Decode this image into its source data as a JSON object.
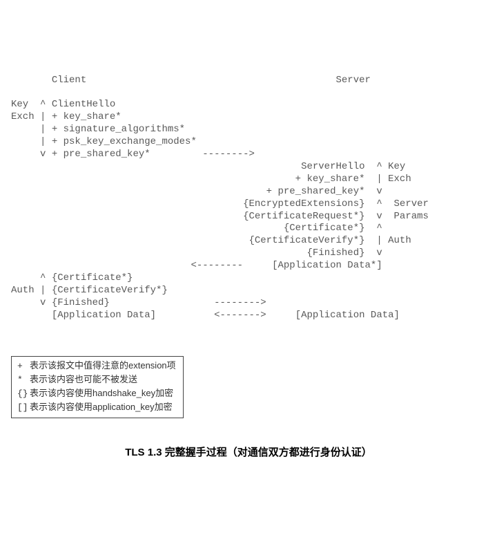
{
  "diagram": {
    "header_client": "Client",
    "header_server": "Server",
    "client_block": {
      "label_key": "Key",
      "label_exch": "Exch",
      "l1_marker": "^",
      "l1": "ClientHello",
      "l2_marker": "|",
      "l2": "+ key_share*",
      "l3_marker": "|",
      "l3": "+ signature_algorithms*",
      "l4_marker": "|",
      "l4": "+ psk_key_exchange_modes*",
      "l5_marker": "v",
      "l5": "+ pre_shared_key*",
      "arrow1": "-------->"
    },
    "server_block": {
      "label_key": "Key",
      "label_exch": "Exch",
      "label_server": "Server",
      "label_params": "Params",
      "label_auth": "Auth",
      "s1": "ServerHello",
      "s1_marker": "^",
      "s2": "+ key_share*",
      "s2_marker": "|",
      "s3": "+ pre_shared_key*",
      "s3_marker": "v",
      "s4": "{EncryptedExtensions}",
      "s4_marker": "^",
      "s5": "{CertificateRequest*}",
      "s5_marker": "v",
      "s6": "{Certificate*}",
      "s6_marker": "^",
      "s7": "{CertificateVerify*}",
      "s7_marker": "|",
      "s8": "{Finished}",
      "s8_marker": "v",
      "s9": "[Application Data*]",
      "arrow2": "<--------"
    },
    "client_auth": {
      "label_auth": "Auth",
      "a1_marker": "^",
      "a1": "{Certificate*}",
      "a2_marker": "|",
      "a2": "{CertificateVerify*}",
      "a3_marker": "v",
      "a3": "{Finished}",
      "arrow3": "-------->",
      "a4": "[Application Data]",
      "arrow4": "<------->",
      "a4_server": "[Application Data]"
    }
  },
  "legend": {
    "items": [
      {
        "sym": "+",
        "text": "表示该报文中值得注意的extension项"
      },
      {
        "sym": "*",
        "text": "表示该内容也可能不被发送"
      },
      {
        "sym": "{}",
        "text": "表示该内容使用handshake_key加密"
      },
      {
        "sym": "[]",
        "text": "表示该内容使用application_key加密"
      }
    ]
  },
  "caption": "TLS 1.3 完整握手过程（对通信双方都进行身份认证）"
}
